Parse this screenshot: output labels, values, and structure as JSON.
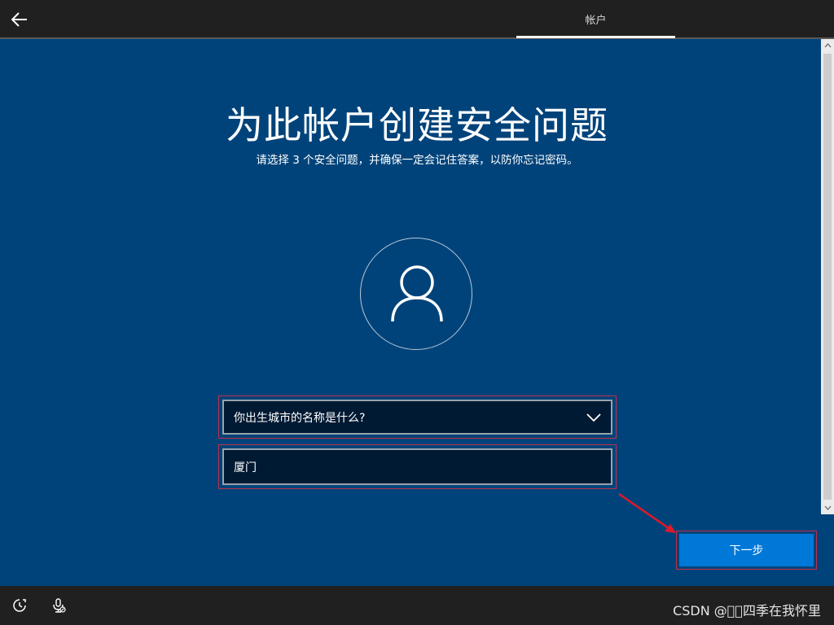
{
  "header": {
    "back_icon": "arrow-left-icon",
    "tab_label": "帐户"
  },
  "main": {
    "title": "为此帐户创建安全问题",
    "subtitle": "请选择 3 个安全问题，并确保一定会记住答案，以防你忘记密码。",
    "avatar_icon": "user-icon",
    "security_question": {
      "selected": "你出生城市的名称是什么?"
    },
    "answer": {
      "value": "厦门"
    },
    "next_label": "下一步"
  },
  "footer": {
    "accessibility_icon": "ease-of-access-icon",
    "mic_icon": "microphone-off-icon",
    "watermark": "CSDN @\u0000\u0000四季在我怀里"
  },
  "colors": {
    "background": "#00437a",
    "bar": "#202020",
    "accent": "#0078d7",
    "highlight_border": "#c0304a",
    "annotation_arrow": "#e0192a"
  }
}
